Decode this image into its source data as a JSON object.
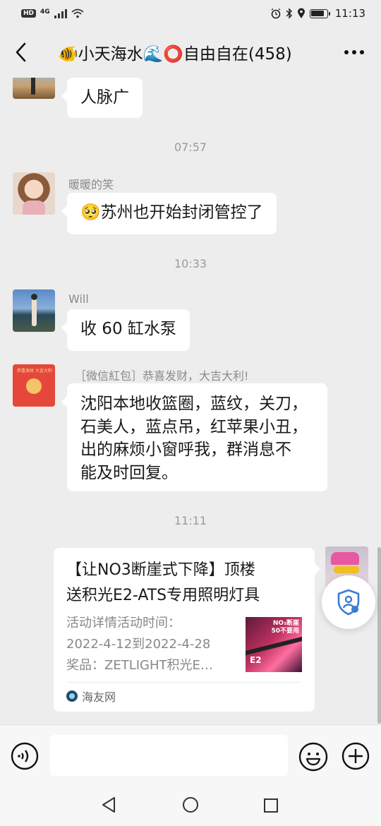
{
  "status_bar": {
    "network": "4G",
    "hd_label": "HD",
    "time": "11:13",
    "battery_level": 0.85,
    "icons": [
      "alarm-icon",
      "bluetooth-icon",
      "location-icon",
      "battery-icon"
    ]
  },
  "header": {
    "title": "🐠小天海水🌊⭕自由自在(458)",
    "back_icon": "chevron-left-icon",
    "more_icon": "more-dots-icon"
  },
  "messages": [
    {
      "type": "bubble",
      "sender": "",
      "text": "人脉广",
      "avatar": "beach-avatar"
    },
    {
      "type": "time",
      "text": "07:57"
    },
    {
      "type": "bubble",
      "sender": "暖暖的笑",
      "text": "🥺苏州也开始封闭管控了",
      "avatar": "girl-avatar"
    },
    {
      "type": "time",
      "text": "10:33"
    },
    {
      "type": "bubble",
      "sender": "Will",
      "text": "收 60 缸水泵",
      "avatar": "will-avatar"
    },
    {
      "type": "bubble",
      "sender": "［微信紅包］恭喜发财，大吉大利!",
      "text_lines": [
        "沈阳本地收篮圈，蓝纹，关刀，",
        "石美人，蓝点吊，红苹果小丑，",
        "出的麻烦小窗呼我，群消息不",
        "能及时回复。"
      ],
      "avatar": "red-packet-avatar"
    },
    {
      "type": "time",
      "text": "11:11"
    }
  ],
  "card": {
    "title_lines": [
      "【让NO3断崖式下降】顶楼",
      "送积光E2-ATS专用照明灯具"
    ],
    "desc_lines": [
      "活动详情活动时间：",
      "2022-4-12到2022-4-28",
      "奖品：ZETLIGHT积光E…"
    ],
    "thumb_text_top": "NO₃断崖\n50不要用",
    "thumb_text_bottom": "E2",
    "source": "海友网"
  },
  "input_bar": {
    "placeholder": "",
    "voice_icon": "voice-icon",
    "emoji_icon": "emoji-icon",
    "plus_icon": "plus-icon"
  },
  "system_nav": {
    "back_icon": "triangle-back-icon",
    "home_icon": "circle-home-icon",
    "recent_icon": "square-recent-icon"
  },
  "colors": {
    "background": "#ededed",
    "bubble": "#ffffff",
    "red_packet": "#e5473b"
  }
}
